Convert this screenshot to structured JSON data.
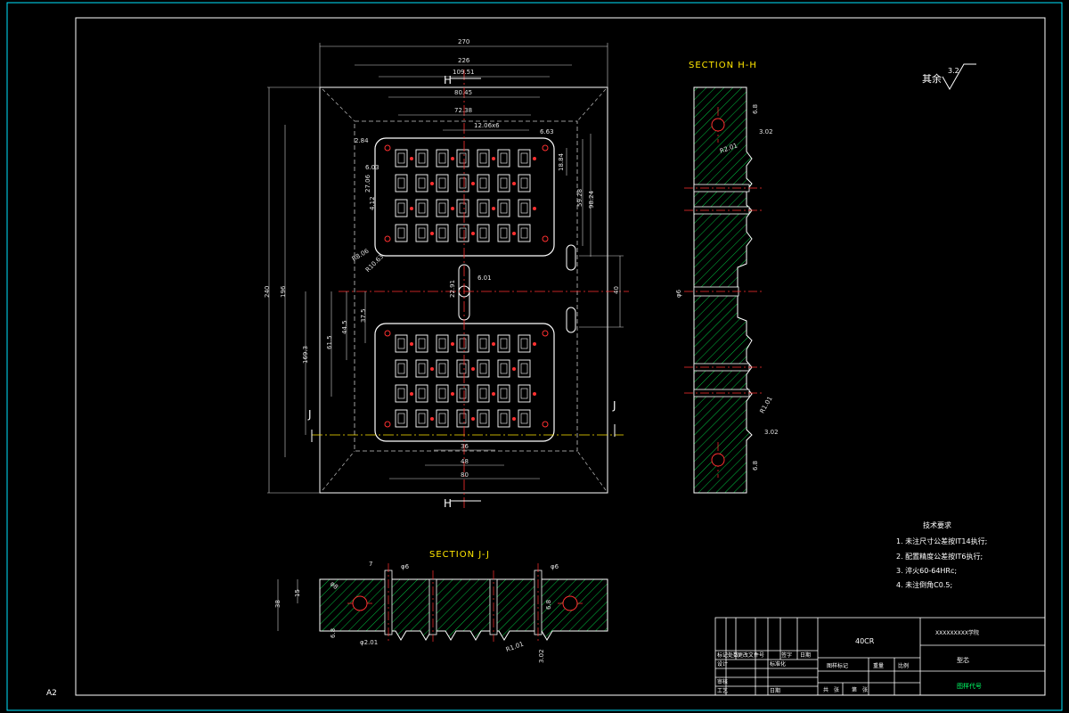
{
  "sheet": {
    "size_label": "A2"
  },
  "colors": {
    "frame": "#00e5ff",
    "section_label": "#ffe600",
    "hatch": "#00c040",
    "centerline": "#ff3030",
    "dim": "#e0e0e0",
    "title_block_green": "#00ff66"
  },
  "roughness": {
    "label": "其余",
    "value": "3.2"
  },
  "main_view": {
    "cut_markers": {
      "h_top": "H",
      "h_bottom": "H",
      "j_left": "J",
      "j_right": "J"
    },
    "dims": {
      "overall_width": "270",
      "w226": "226",
      "w19": "109.51",
      "w8045": "80.45",
      "w7238": "72.38",
      "w1206": "12.06x6",
      "d66": "6.63",
      "d284": "2.84",
      "d603": "6.03",
      "d27": "27.06",
      "d412": "4.12",
      "d1884": "18.84",
      "d5928": "59.28",
      "d9824": "98.24",
      "r806": "R8.06",
      "r1063": "R10.63",
      "d2291": "22.91",
      "d601": "6.01",
      "d40": "40",
      "h240": "240",
      "h196": "196",
      "h1693": "169.3",
      "h615": "61.5",
      "h445": "44.5",
      "h375": "37.5",
      "b36": "36",
      "b48": "48",
      "b80": "80"
    }
  },
  "section_hh": {
    "title": "SECTION H-H",
    "dims": {
      "d302a": "3.02",
      "d6": "6.8",
      "r201": "R2.01",
      "phi6": "φ6",
      "r101": "R1.01",
      "d302b": "3.02",
      "d68": "6.8"
    }
  },
  "section_jj": {
    "title": "SECTION J-J",
    "dims": {
      "d7": "7",
      "phi6a": "φ6",
      "phi6b": "φ6",
      "d15": "15",
      "d38": "38",
      "phi8": "φ8",
      "d68": "6.8",
      "phi201": "φ2.01",
      "r101": "R1.01",
      "d302": "3.02",
      "d68b": "6.8"
    }
  },
  "tech_notes": {
    "title": "技术要求",
    "items": [
      "1. 未注尺寸公差按IT14执行;",
      "2. 配置精度公差按IT6执行;",
      "3. 淬火60-64HRc;",
      "4. 未注倒角C0.5;"
    ]
  },
  "title_block": {
    "material": "40CR",
    "school": "XXXXXXXXX学院",
    "drawing_name": "型芯",
    "drawing_no": "图样代号",
    "labels": {
      "mark": "标记",
      "count": "处数",
      "file_no": "更改文件号",
      "sign": "签字",
      "date": "日期",
      "design": "设计",
      "standard": "标准化",
      "check": "审核",
      "process": "工艺",
      "date2": "日期",
      "stage_mark": "图样标记",
      "weight": "重量",
      "scale": "比例",
      "total": "共",
      "sheet": "张",
      "page": "第",
      "sheet2": "张"
    }
  }
}
